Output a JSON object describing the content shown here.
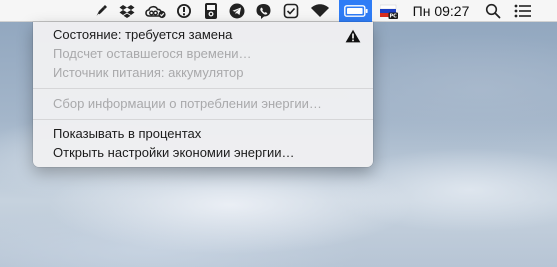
{
  "menubar": {
    "icons": [
      "pen-tool-icon",
      "dropbox-icon",
      "creative-cloud-icon",
      "exclamation-icon",
      "sync-device-icon",
      "telegram-icon",
      "viber-icon",
      "shield-check-icon",
      "wifi-icon",
      "battery-icon",
      "russian-flag-icon",
      "search-icon",
      "notification-center-icon"
    ],
    "input_source_badge": "PC",
    "clock": "Пн 09:27"
  },
  "battery_menu": {
    "status": "Состояние: требуется замена",
    "time_remaining": "Подсчет оставшегося времени…",
    "power_source": "Источник питания: аккумулятор",
    "energy_usage": "Сбор информации о потреблении энергии…",
    "show_percentage": "Показывать в процентах",
    "open_energy_prefs": "Открыть настройки экономии энергии…"
  },
  "colors": {
    "accent": "#2e7cf6",
    "disabled_text": "#a9a9ab",
    "menu_bg": "#f0f0f2"
  }
}
